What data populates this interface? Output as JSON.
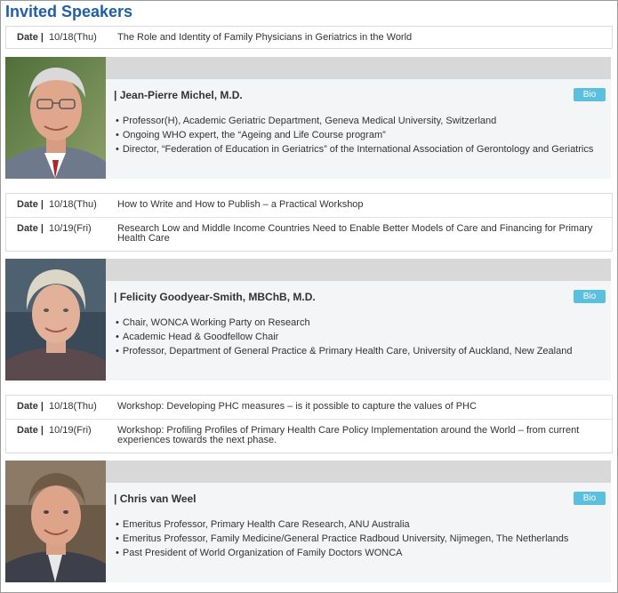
{
  "page_title": "Invited Speakers",
  "schedules": [
    {
      "rows": [
        {
          "label": "Date",
          "date": "10/18(Thu)",
          "title": "The Role and Identity of Family Physicians in Geriatrics in the World"
        }
      ]
    },
    {
      "rows": [
        {
          "label": "Date",
          "date": "10/18(Thu)",
          "title": "How to Write and How to Publish – a Practical Workshop"
        },
        {
          "label": "Date",
          "date": "10/19(Fri)",
          "title": "Research Low and Middle Income Countries Need to Enable Better Models of Care and Financing for Primary Health Care"
        }
      ]
    },
    {
      "rows": [
        {
          "label": "Date",
          "date": "10/18(Thu)",
          "title": "Workshop: Developing PHC measures – is it possible to capture the values of PHC"
        },
        {
          "label": "Date",
          "date": "10/19(Fri)",
          "title": "Workshop: Profiling Profiles of Primary Health Care Policy Implementation around the World – from current experiences towards the next phase."
        }
      ]
    }
  ],
  "speakers": [
    {
      "name": "| Jean-Pierre Michel, M.D.",
      "bio_label": "Bio",
      "items": [
        "Professor(H), Academic Geriatric Department, Geneva Medical University, Switzerland",
        "Ongoing WHO expert, the “Ageing and Life Course program”",
        "Director, “Federation of Education in Geriatrics” of the International Association of Gerontology and Geriatrics"
      ]
    },
    {
      "name": "| Felicity Goodyear-Smith, MBChB, M.D.",
      "bio_label": "Bio",
      "items": [
        "Chair, WONCA Working Party on Research",
        "Academic Head & Goodfellow Chair",
        "Professor, Department of General Practice & Primary Health Care, University of Auckland, New Zealand"
      ]
    },
    {
      "name": "| Chris van Weel",
      "bio_label": "Bio",
      "items": [
        "Emeritus Professor, Primary Health Care Research, ANU Australia",
        "Emeritus Professor, Family Medicine/General Practice Radboud University, Nijmegen, The Netherlands",
        "Past President of World Organization of Family Doctors WONCA"
      ]
    }
  ],
  "colors": {
    "heading": "#1f5ea8",
    "bio_button": "#5bc0de",
    "speaker_bar": "#d8d8d8",
    "panel": "#f4f5f6"
  }
}
